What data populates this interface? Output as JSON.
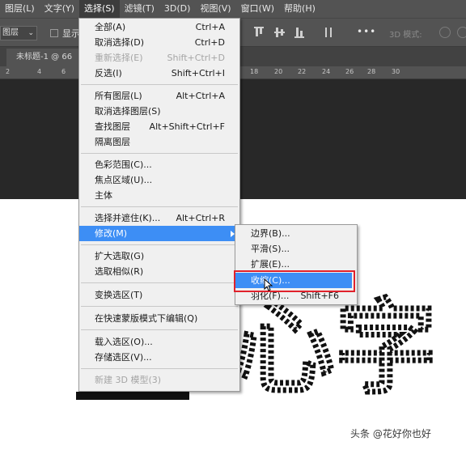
{
  "menubar": {
    "items": [
      "图层(L)",
      "文字(Y)",
      "选择(S)",
      "滤镜(T)",
      "3D(D)",
      "视图(V)",
      "窗口(W)",
      "帮助(H)"
    ]
  },
  "options_bar": {
    "layer_select": "图层",
    "show_label": "显示",
    "more": "•••",
    "mode_3d": "3D 模式:"
  },
  "tab": {
    "title": "未标题-1 @ 66"
  },
  "ruler": {
    "ticks": [
      "2",
      "4",
      "6",
      "18",
      "20",
      "22",
      "24",
      "26",
      "28",
      "30"
    ]
  },
  "select_menu": {
    "items": [
      {
        "label": "全部(A)",
        "shortcut": "Ctrl+A"
      },
      {
        "label": "取消选择(D)",
        "shortcut": "Ctrl+D"
      },
      {
        "label": "重新选择(E)",
        "shortcut": "Shift+Ctrl+D"
      },
      {
        "label": "反选(I)",
        "shortcut": "Shift+Ctrl+I"
      },
      {
        "label": "所有图层(L)",
        "shortcut": "Alt+Ctrl+A"
      },
      {
        "label": "取消选择图层(S)",
        "shortcut": ""
      },
      {
        "label": "查找图层",
        "shortcut": "Alt+Shift+Ctrl+F"
      },
      {
        "label": "隔离图层",
        "shortcut": ""
      },
      {
        "label": "色彩范围(C)...",
        "shortcut": ""
      },
      {
        "label": "焦点区域(U)...",
        "shortcut": ""
      },
      {
        "label": "主体",
        "shortcut": ""
      },
      {
        "label": "选择并遮住(K)...",
        "shortcut": "Alt+Ctrl+R"
      },
      {
        "label": "修改(M)",
        "shortcut": ""
      },
      {
        "label": "扩大选取(G)",
        "shortcut": ""
      },
      {
        "label": "选取相似(R)",
        "shortcut": ""
      },
      {
        "label": "变换选区(T)",
        "shortcut": ""
      },
      {
        "label": "在快速蒙版模式下编辑(Q)",
        "shortcut": ""
      },
      {
        "label": "载入选区(O)...",
        "shortcut": ""
      },
      {
        "label": "存储选区(V)...",
        "shortcut": ""
      },
      {
        "label": "新建 3D 模型(3)",
        "shortcut": ""
      }
    ]
  },
  "modify_submenu": {
    "items": [
      {
        "label": "边界(B)...",
        "shortcut": ""
      },
      {
        "label": "平滑(S)...",
        "shortcut": ""
      },
      {
        "label": "扩展(E)...",
        "shortcut": ""
      },
      {
        "label": "收缩(C)...",
        "shortcut": ""
      },
      {
        "label": "羽化(F)...",
        "shortcut": "Shift+F6"
      }
    ]
  },
  "canvas": {
    "text": "心字"
  },
  "watermark": "头条 @花好你也好",
  "colors": {
    "menu_highlight": "#3d8ef5",
    "callout_box": "#e0212b",
    "chrome": "#535353",
    "workarea": "#282828"
  }
}
